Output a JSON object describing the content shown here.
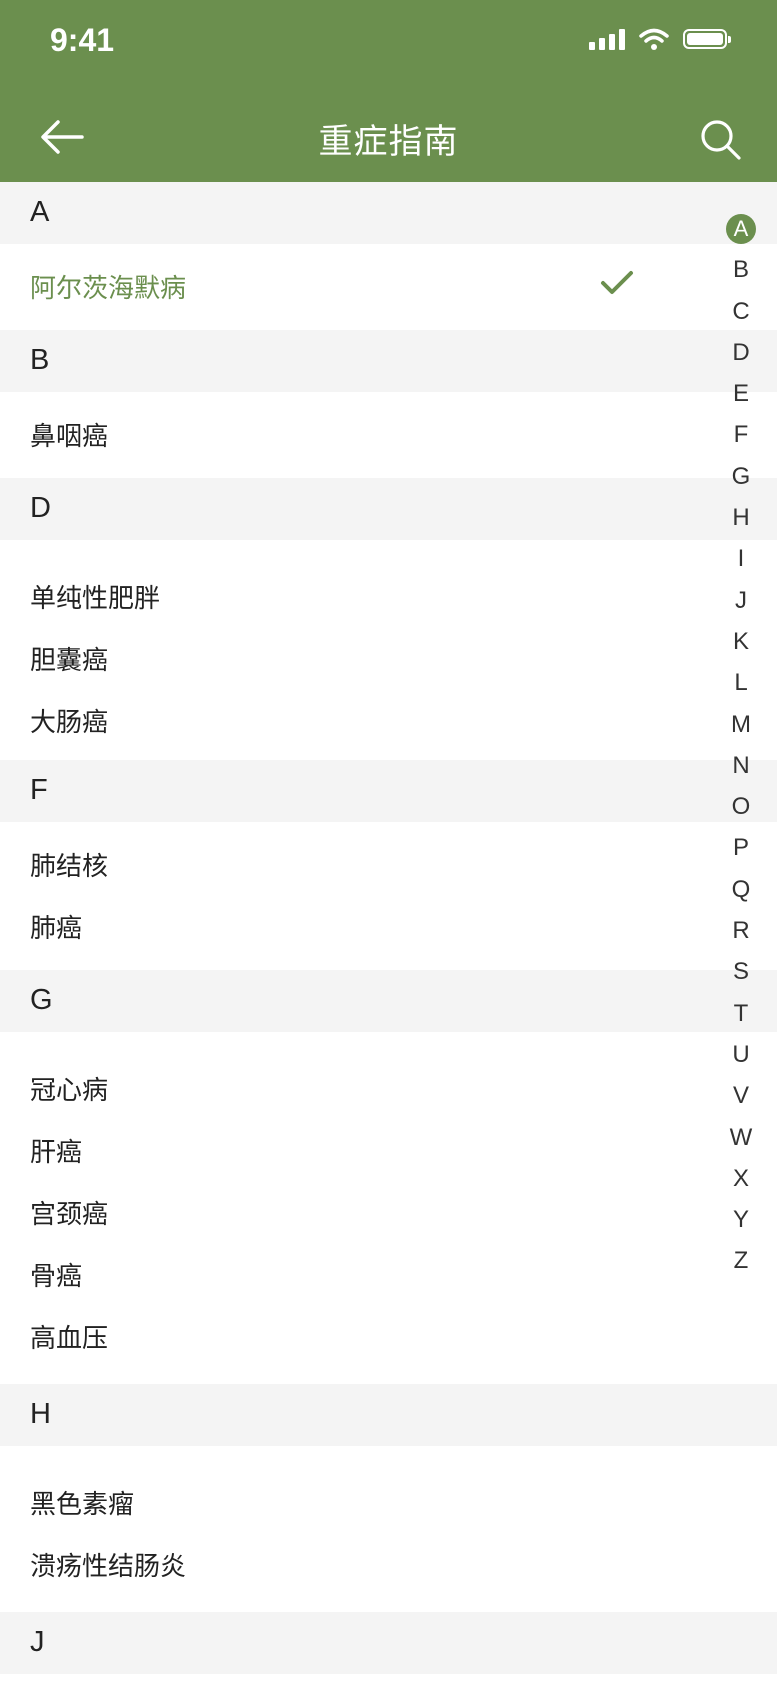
{
  "status_bar": {
    "time": "9:41"
  },
  "header": {
    "title": "重症指南",
    "accent": "#6b8f4e"
  },
  "icons": {
    "back": "arrow-left-icon",
    "search": "search-icon",
    "check": "checkmark-icon"
  },
  "sections": [
    {
      "letter": "A",
      "items": [
        {
          "label": "阿尔茨海默病",
          "selected": true
        }
      ]
    },
    {
      "letter": "B",
      "items": [
        {
          "label": "鼻咽癌"
        }
      ]
    },
    {
      "letter": "D",
      "items": [
        {
          "label": "单纯性肥胖"
        },
        {
          "label": "胆囊癌"
        },
        {
          "label": "大肠癌"
        }
      ]
    },
    {
      "letter": "F",
      "items": [
        {
          "label": "肺结核"
        },
        {
          "label": "肺癌"
        }
      ]
    },
    {
      "letter": "G",
      "items": [
        {
          "label": "冠心病"
        },
        {
          "label": "肝癌"
        },
        {
          "label": "宫颈癌"
        },
        {
          "label": "骨癌"
        },
        {
          "label": "高血压"
        }
      ]
    },
    {
      "letter": "H",
      "items": [
        {
          "label": "黑色素瘤"
        },
        {
          "label": "溃疡性结肠炎"
        }
      ]
    },
    {
      "letter": "J",
      "items": []
    }
  ],
  "index": [
    "A",
    "B",
    "C",
    "D",
    "E",
    "F",
    "G",
    "H",
    "I",
    "J",
    "K",
    "L",
    "M",
    "N",
    "O",
    "P",
    "Q",
    "R",
    "S",
    "T",
    "U",
    "V",
    "W",
    "X",
    "Y",
    "Z"
  ],
  "index_active": "A"
}
